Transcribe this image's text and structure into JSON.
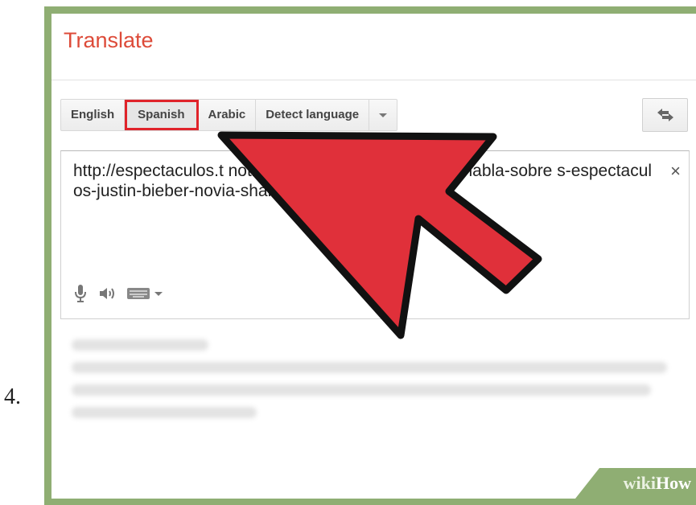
{
  "step_number": "4.",
  "header": {
    "title": "Translate"
  },
  "language_tabs": [
    {
      "label": "English",
      "active": false
    },
    {
      "label": "Spanish",
      "active": true
    },
    {
      "label": "Arabic",
      "active": false
    },
    {
      "label": "Detect language",
      "active": false
    }
  ],
  "source": {
    "text": "http://espectaculos.t                                   noticias/846982/selena-gomez-habla-sobre                    s-espectaculos-justin-bieber-novia-shanina-sh",
    "clear_icon": "×"
  },
  "watermark": {
    "part1": "wiki",
    "part2": "How"
  },
  "colors": {
    "title": "#dd4b39",
    "highlight": "#e0232a",
    "arrow": "#e0303a",
    "frame": "#8fae73"
  },
  "icons": [
    "swap-languages-icon",
    "microphone-icon",
    "speaker-icon",
    "keyboard-icon",
    "chevron-down-icon",
    "close-icon"
  ]
}
